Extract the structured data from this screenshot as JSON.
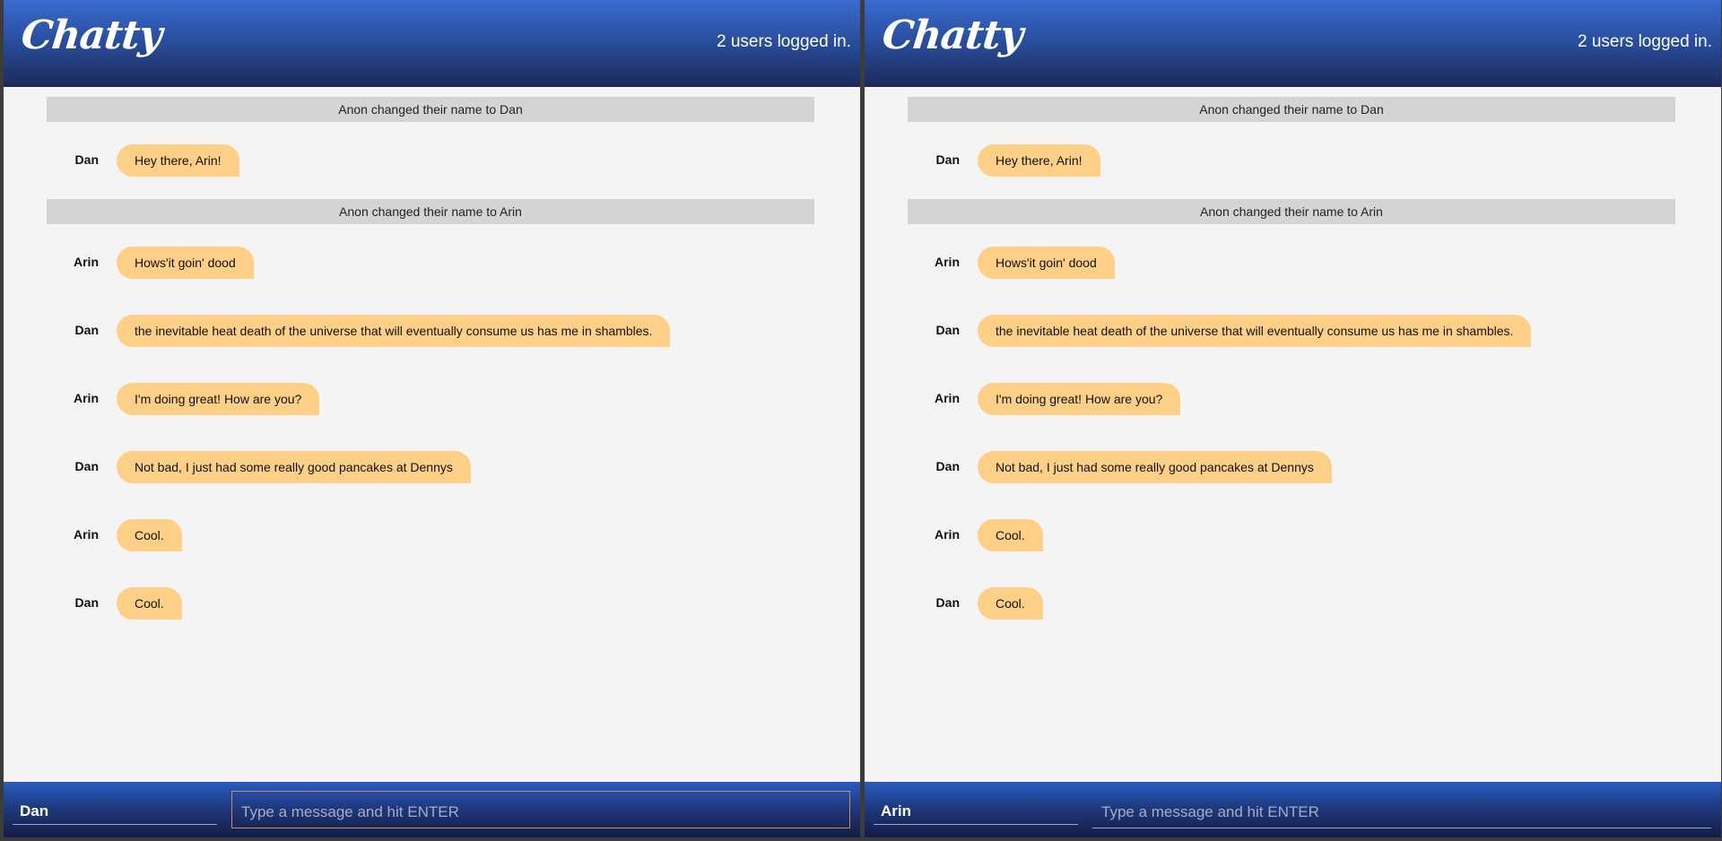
{
  "colors": {
    "navbar_top": "#3a6bd0",
    "navbar_bottom": "#1c2a5a",
    "bubble": "#fdcf87",
    "system_notice_bg": "#d4d4d4",
    "page_bg": "#f4f4f4",
    "focus_border": "#d08a5a"
  },
  "panes": [
    {
      "brand": "Chatty",
      "user_count": "2 users logged in.",
      "messages": [
        {
          "type": "system",
          "text": "Anon changed their name to Dan"
        },
        {
          "type": "chat",
          "user": "Dan",
          "text": "Hey there, Arin!"
        },
        {
          "type": "system",
          "text": "Anon changed their name to Arin"
        },
        {
          "type": "chat",
          "user": "Arin",
          "text": "Hows'it goin' dood"
        },
        {
          "type": "chat",
          "user": "Dan",
          "text": "the inevitable heat death of the universe that will eventually consume us has me in shambles."
        },
        {
          "type": "chat",
          "user": "Arin",
          "text": "I'm doing great! How are you?"
        },
        {
          "type": "chat",
          "user": "Dan",
          "text": "Not bad, I just had some really good pancakes at Dennys"
        },
        {
          "type": "chat",
          "user": "Arin",
          "text": "Cool."
        },
        {
          "type": "chat",
          "user": "Dan",
          "text": "Cool."
        }
      ],
      "name_value": "Dan",
      "message_placeholder": "Type a message and hit ENTER",
      "message_value": ""
    },
    {
      "brand": "Chatty",
      "user_count": "2 users logged in.",
      "messages": [
        {
          "type": "system",
          "text": "Anon changed their name to Dan"
        },
        {
          "type": "chat",
          "user": "Dan",
          "text": "Hey there, Arin!"
        },
        {
          "type": "system",
          "text": "Anon changed their name to Arin"
        },
        {
          "type": "chat",
          "user": "Arin",
          "text": "Hows'it goin' dood"
        },
        {
          "type": "chat",
          "user": "Dan",
          "text": "the inevitable heat death of the universe that will eventually consume us has me in shambles."
        },
        {
          "type": "chat",
          "user": "Arin",
          "text": "I'm doing great! How are you?"
        },
        {
          "type": "chat",
          "user": "Dan",
          "text": "Not bad, I just had some really good pancakes at Dennys"
        },
        {
          "type": "chat",
          "user": "Arin",
          "text": "Cool."
        },
        {
          "type": "chat",
          "user": "Dan",
          "text": "Cool."
        }
      ],
      "name_value": "Arin",
      "message_placeholder": "Type a message and hit ENTER",
      "message_value": ""
    }
  ]
}
